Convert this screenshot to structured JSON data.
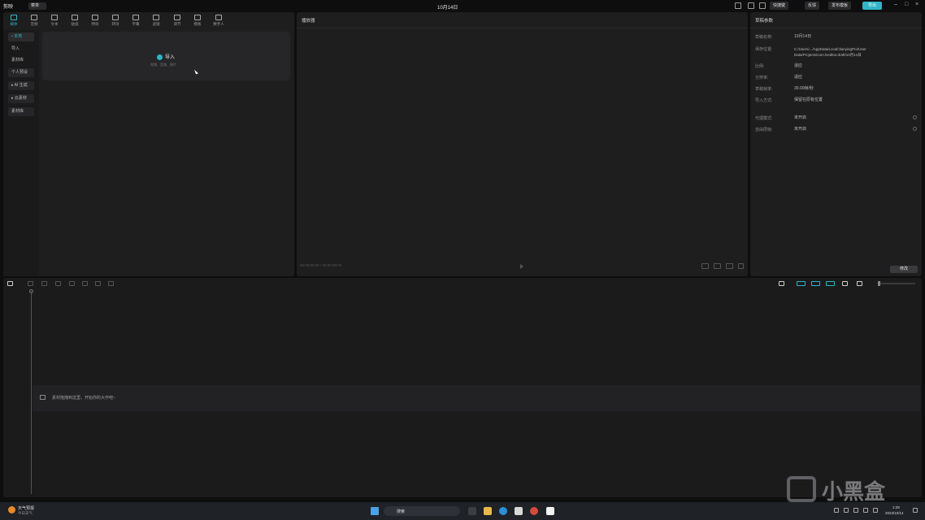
{
  "titlebar": {
    "logo": "剪映",
    "menu": "菜单",
    "title": "10月14日",
    "shortcut_btn": "快捷键",
    "feedback_btn": "反馈",
    "publish_btn": "发布模板",
    "export_btn": "导出"
  },
  "toolbar": {
    "items": [
      {
        "label": "媒体"
      },
      {
        "label": "音频"
      },
      {
        "label": "文本"
      },
      {
        "label": "贴纸"
      },
      {
        "label": "特效"
      },
      {
        "label": "转场"
      },
      {
        "label": "字幕"
      },
      {
        "label": "滤镜"
      },
      {
        "label": "调节"
      },
      {
        "label": "模板"
      },
      {
        "label": "数字人"
      }
    ]
  },
  "sidebar": {
    "items": [
      {
        "label": "• 本地"
      },
      {
        "label": "导入"
      },
      {
        "label": "素材库"
      },
      {
        "label": "个人预设"
      },
      {
        "label": "▸ AI 生成"
      },
      {
        "label": "▸ 云素材"
      },
      {
        "label": "素材库"
      }
    ]
  },
  "import": {
    "label": "导入",
    "hint": "视频、音频、图片"
  },
  "player": {
    "title": "播放器",
    "time": "00:00:00:00 / 00:00:00:00"
  },
  "draft": {
    "title": "草稿参数",
    "rows": [
      {
        "key": "草稿名称:",
        "value": "10月14日"
      },
      {
        "key": "保存位置:",
        "value": "C:/Users/.../AppData/Local/JianyingPro/User Data/Projects/com.lveditor.draft/10月14日"
      },
      {
        "key": "比例:",
        "value": "适应"
      },
      {
        "key": "分辨率:",
        "value": "适应"
      },
      {
        "key": "草稿帧率:",
        "value": "30.00帧/秒"
      },
      {
        "key": "导入方式:",
        "value": "保留在原有位置"
      },
      {
        "key": "代理模式:",
        "value": "未开启"
      },
      {
        "key": "自由层级:",
        "value": "未开启"
      }
    ],
    "modify_btn": "修改"
  },
  "timeline": {
    "hint": "素材拖拽到这里，开始你的大作吧~"
  },
  "taskbar": {
    "weather_title": "天气预报",
    "weather_sub": "今日天气",
    "search": "搜索",
    "time": "1:28",
    "date": "2023/10/14"
  },
  "watermark": {
    "text": "小黑盒"
  },
  "colors": {
    "accent": "#2fb5c6",
    "panel": "#1e1e1f",
    "background": "#0e0e0f"
  }
}
